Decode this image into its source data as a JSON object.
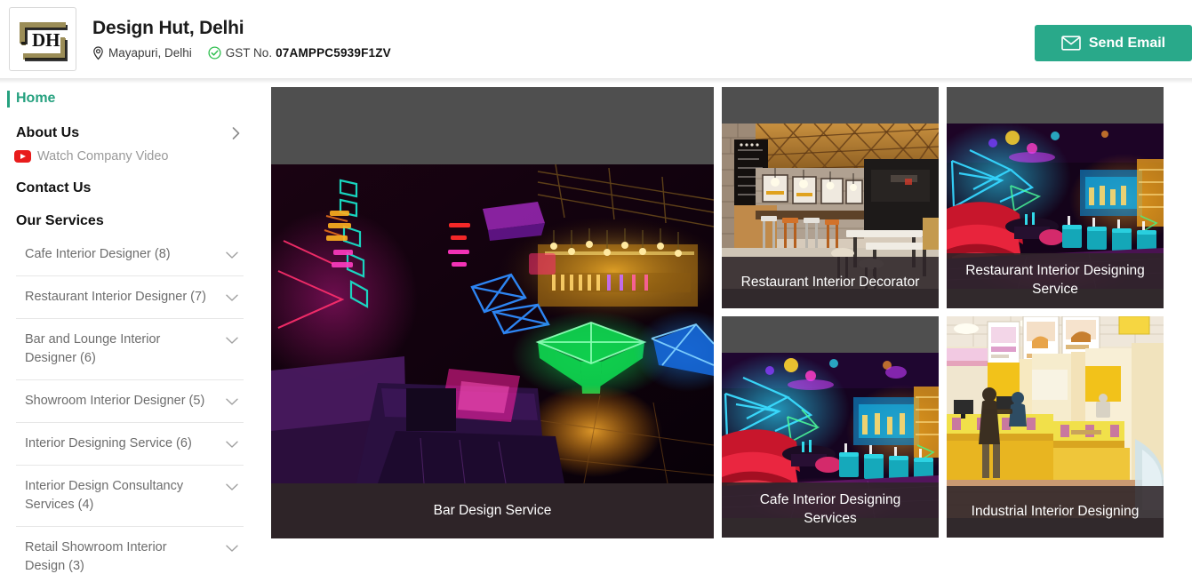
{
  "header": {
    "logo_alt": "DH",
    "company_name": "Design Hut, Delhi",
    "location": "Mayapuri, Delhi",
    "gst_label": "GST No.",
    "gst_value": "07AMPPC5939F1ZV",
    "send_email_label": "Send Email",
    "accent_color": "#29a98a"
  },
  "sidebar": {
    "home_label": "Home",
    "about_label": "About Us",
    "watch_video_label": "Watch Company Video",
    "contact_label": "Contact Us",
    "services_heading": "Our Services",
    "services": [
      {
        "label": "Cafe Interior Designer (8)"
      },
      {
        "label": "Restaurant Interior Designer (7)"
      },
      {
        "label": "Bar and Lounge Interior Designer (6)"
      },
      {
        "label": "Showroom Interior Designer (5)"
      },
      {
        "label": "Interior Designing Service (6)"
      },
      {
        "label": "Interior Design Consultancy Services (4)"
      },
      {
        "label": "Retail Showroom Interior Design (3)"
      }
    ]
  },
  "main": {
    "featured": {
      "caption": "Bar Design Service",
      "image_alt": "neon-lit bar lounge interior with glowing sofas and colorful light art"
    },
    "cards": [
      {
        "caption": "Restaurant Interior Decorator",
        "image_alt": "warm wooden cafe interior with lattice ceiling, chalkboard menu, stools and tables"
      },
      {
        "caption": "Restaurant Interior Designing Service",
        "image_alt": "neon restaurant lounge with red curved sofa and blue light patterns"
      },
      {
        "caption": "Cafe Interior Designing Services",
        "image_alt": "neon cafe lounge with red sofa, teal stools and purple floor"
      },
      {
        "caption": "Industrial Interior Designing",
        "image_alt": "bright yellow retail service counter with menu boards and staff"
      }
    ]
  },
  "icons": {
    "location": "location-pin-icon",
    "verified": "verified-check-icon",
    "mail": "envelope-icon",
    "chevron_right": "chevron-right-icon",
    "chevron_down": "chevron-down-icon",
    "youtube": "youtube-play-icon"
  }
}
